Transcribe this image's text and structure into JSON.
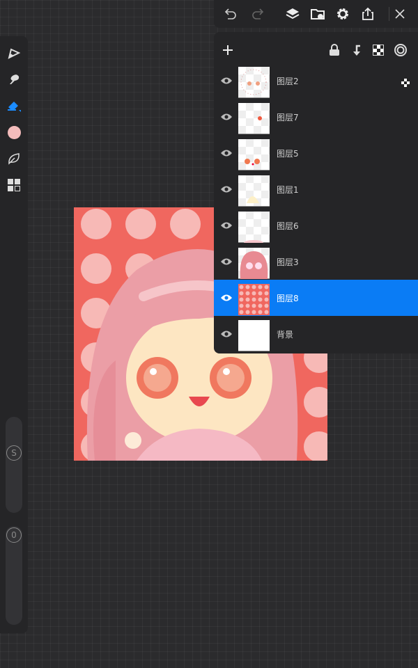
{
  "toolbar": {
    "undo": "undo-icon",
    "redo": "redo-icon",
    "layers": "layers-icon",
    "import": "folder-import-icon",
    "settings": "gear-icon",
    "export": "share-icon",
    "close": "close-icon"
  },
  "tools": [
    "pencil-icon",
    "smudge-icon",
    "eraser-icon",
    "color-swatch",
    "leaf-brush-icon",
    "grid-gallery-icon"
  ],
  "current_color": "#f4bcbc",
  "sliders": {
    "size_label": "S",
    "opacity_label": "0"
  },
  "layers_panel": {
    "actions": [
      "add-icon",
      "lock-icon",
      "merge-down-icon",
      "alpha-lock-icon",
      "blend-icon"
    ],
    "layers": [
      {
        "name": "图层2",
        "visible": true,
        "selected": false,
        "alpha_locked": true
      },
      {
        "name": "图层7",
        "visible": true,
        "selected": false
      },
      {
        "name": "图层5",
        "visible": true,
        "selected": false
      },
      {
        "name": "图层1",
        "visible": true,
        "selected": false
      },
      {
        "name": "图层6",
        "visible": true,
        "selected": false
      },
      {
        "name": "图层3",
        "visible": true,
        "selected": false
      },
      {
        "name": "图层8",
        "visible": true,
        "selected": true
      },
      {
        "name": "背景",
        "visible": true,
        "selected": false
      }
    ]
  },
  "accent": "#0a7cf5"
}
